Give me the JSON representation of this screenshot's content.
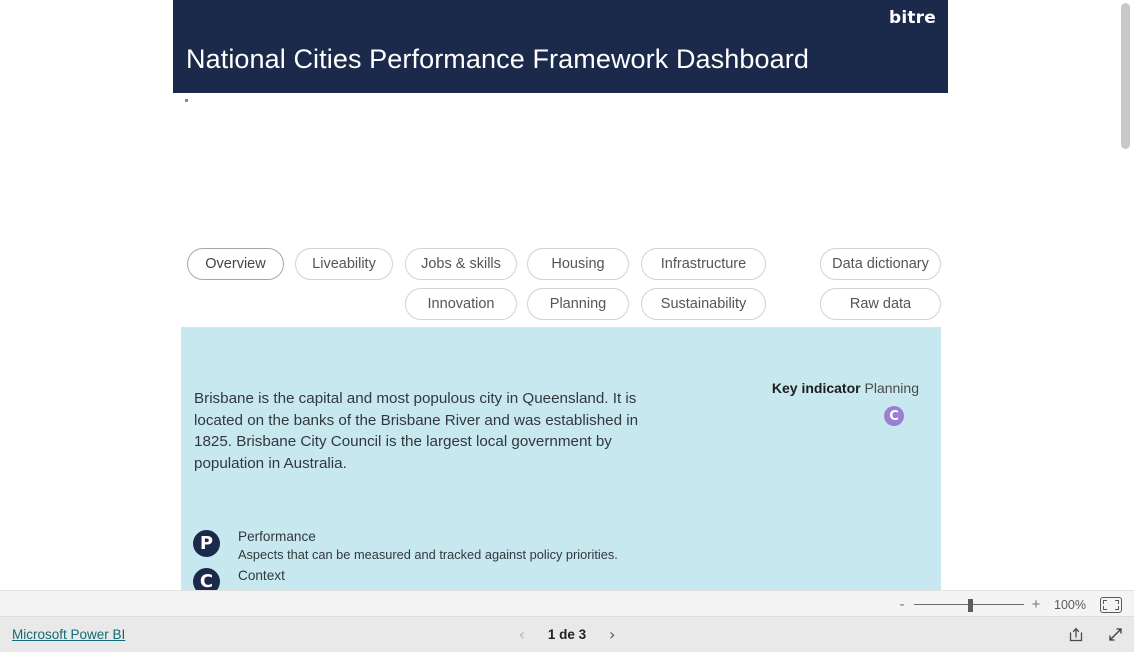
{
  "banner": {
    "logo": "bitre",
    "title": "National Cities Performance Framework Dashboard",
    "background": "#1b2a4a"
  },
  "nav": {
    "buttons": [
      {
        "label": "Overview",
        "selected": true,
        "row": 1
      },
      {
        "label": "Liveability",
        "selected": false,
        "row": 1
      },
      {
        "label": "Jobs & skills",
        "selected": false,
        "row": 1
      },
      {
        "label": "Housing",
        "selected": false,
        "row": 1
      },
      {
        "label": "Infrastructure",
        "selected": false,
        "row": 1
      },
      {
        "label": "Data dictionary",
        "selected": false,
        "row": 1
      },
      {
        "label": "Innovation",
        "selected": false,
        "row": 2
      },
      {
        "label": "Planning",
        "selected": false,
        "row": 2
      },
      {
        "label": "Sustainability",
        "selected": false,
        "row": 2
      },
      {
        "label": "Raw data",
        "selected": false,
        "row": 2
      }
    ]
  },
  "panel": {
    "background": "#c7e8ef",
    "city_description": "Brisbane is the capital and most populous city in Queensland. It is located on the banks of the Brisbane River and was established in 1825. Brisbane City Council is the largest local government by population in Australia.",
    "key_indicator": {
      "label": "Key indicator",
      "value": "Planning",
      "badge_letter": "C",
      "badge_color": "#9b7fd4"
    },
    "legend": [
      {
        "badge": "P",
        "title": "Performance",
        "description": "Aspects that can be measured and tracked against policy priorities."
      },
      {
        "badge": "C",
        "title": "Context",
        "description": ""
      }
    ],
    "legend_badge_color": "#1b2a4a"
  },
  "statusbar": {
    "zoom_minus": "-",
    "zoom_plus": "+",
    "zoom_value": "100%",
    "fit_icon": "fit-to-page-icon"
  },
  "footer": {
    "powerbi_link": "Microsoft Power BI",
    "powerbi_link_color": "#0f6c78",
    "pager": {
      "prev": "‹",
      "label": "1 de 3",
      "next": "›"
    },
    "icons": [
      {
        "name": "share-icon"
      },
      {
        "name": "fullscreen-icon"
      }
    ]
  }
}
